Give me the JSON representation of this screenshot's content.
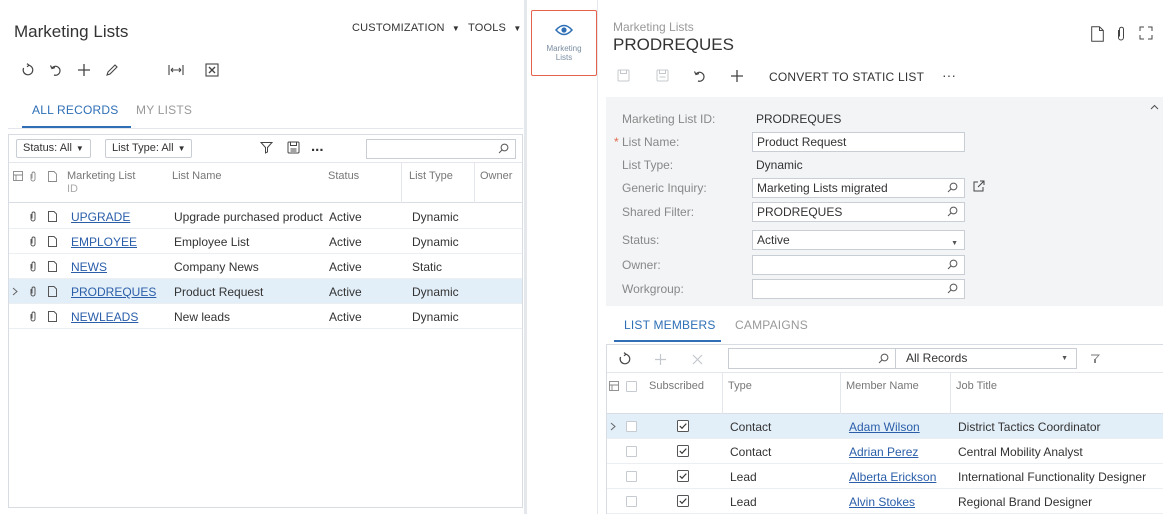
{
  "left": {
    "title": "Marketing Lists",
    "menu": {
      "customization": "CUSTOMIZATION",
      "tools": "TOOLS"
    },
    "toolbar_icons": [
      "refresh-icon",
      "undo-icon",
      "add-icon",
      "edit-icon",
      "fit-to-screen-icon",
      "export-excel-icon"
    ],
    "tabs": [
      {
        "label": "ALL RECORDS",
        "active": true
      },
      {
        "label": "MY LISTS",
        "active": false
      }
    ],
    "filters": {
      "status": "Status: All",
      "list_type": "List Type: All",
      "more": "...",
      "search_placeholder": ""
    },
    "columns": {
      "list_id": "Marketing List",
      "list_id_2": "ID",
      "name": "List Name",
      "status": "Status",
      "type": "List Type",
      "owner": "Owner"
    },
    "rows": [
      {
        "id": "UPGRADE",
        "name": "Upgrade purchased product",
        "status": "Active",
        "type": "Dynamic",
        "owner": ""
      },
      {
        "id": "EMPLOYEE",
        "name": "Employee List",
        "status": "Active",
        "type": "Dynamic",
        "owner": ""
      },
      {
        "id": "NEWS",
        "name": "Company News",
        "status": "Active",
        "type": "Static",
        "owner": ""
      },
      {
        "id": "PRODREQUES",
        "name": "Product Request",
        "status": "Active",
        "type": "Dynamic",
        "owner": ""
      },
      {
        "id": "NEWLEADS",
        "name": "New leads",
        "status": "Active",
        "type": "Dynamic",
        "owner": ""
      }
    ],
    "selected_row": 3
  },
  "side_pane": {
    "label_1": "Marketing",
    "label_2": "Lists"
  },
  "right": {
    "breadcrumb": "Marketing Lists",
    "title": "PRODREQUES",
    "convert_button": "CONVERT TO STATIC LIST",
    "more": "···",
    "fields": {
      "list_id_label": "Marketing List ID:",
      "list_id": "PRODREQUES",
      "list_name_label": "List Name:",
      "list_name": "Product Request",
      "list_type_label": "List Type:",
      "list_type": "Dynamic",
      "gi_label": "Generic Inquiry:",
      "gi": "Marketing Lists migrated",
      "shared_filter_label": "Shared Filter:",
      "shared_filter": "PRODREQUES",
      "status_label": "Status:",
      "status": "Active",
      "owner_label": "Owner:",
      "owner": "",
      "workgroup_label": "Workgroup:",
      "workgroup": "",
      "required_marker": "*"
    },
    "tabs": [
      {
        "label": "LIST MEMBERS",
        "active": true
      },
      {
        "label": "CAMPAIGNS",
        "active": false
      }
    ],
    "members_toolbar": {
      "search_placeholder": "",
      "records_filter": "All Records"
    },
    "members_columns": {
      "subscribed": "Subscribed",
      "type": "Type",
      "member_name": "Member Name",
      "job_title": "Job Title"
    },
    "members": [
      {
        "subscribed": true,
        "type": "Contact",
        "name": "Adam Wilson",
        "job": "District Tactics Coordinator"
      },
      {
        "subscribed": true,
        "type": "Contact",
        "name": "Adrian Perez",
        "job": "Central Mobility Analyst"
      },
      {
        "subscribed": true,
        "type": "Lead",
        "name": "Alberta Erickson",
        "job": "International Functionality Designer"
      },
      {
        "subscribed": true,
        "type": "Lead",
        "name": "Alvin Stokes",
        "job": "Regional Brand Designer"
      }
    ]
  },
  "colors": {
    "accent": "#2e6fb6",
    "link": "#2a5ea9",
    "selected_row": "#e3eff8",
    "highlight_border": "#e4634a"
  }
}
